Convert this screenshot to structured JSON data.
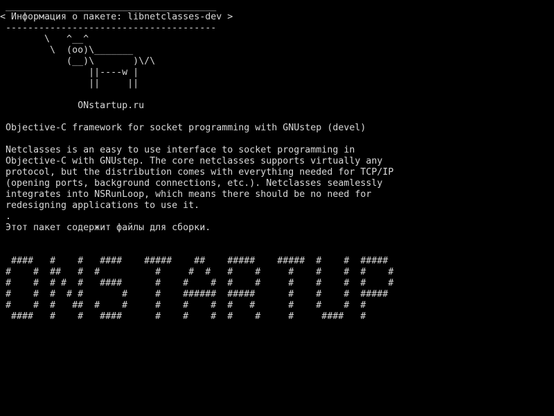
{
  "terminal": {
    "colors": {
      "background": "#000000",
      "foreground": "#d8d8d8"
    },
    "bubble": {
      "top_border": " ______________________________________",
      "text": "< Информация о пакете: libnetclasses-dev >",
      "bottom_border": " --------------------------------------"
    },
    "cow": {
      "lines": [
        "       \\   ^__^",
        "        \\  (oo)\\_______",
        "           (__)\\       )\\/\\",
        "               ||----w |",
        "               ||     ||"
      ]
    },
    "site": "             ONstartup.ru",
    "summary": "Objective-C framework for socket programming with GNUstep (devel)",
    "description": [
      "Netclasses is an easy to use interface to socket programming in",
      "Objective-C with GNUstep. The core netclasses supports virtually any",
      "protocol, but the distribution comes with everything needed for TCP/IP",
      "(opening ports, background connections, etc.). Netclasses seamlessly",
      "integrates into NSRunLoop, which means there should be no need for",
      "redesigning applications to use it.",
      "."
    ],
    "note": "Этот пакет содержит файлы для сборки.",
    "banner": [
      " ####   #    #   ####    #####    ##    #####    #####  #    #  #####",
      "#    #  ##   #  #          #     #  #   #    #     #    #    #  #    #",
      "#    #  # #  #   ####      #    #    #  #    #     #    #    #  #    #",
      "#    #  #  # #       #     #    ######  #####      #    #    #  #####",
      "#    #  #   ##  #    #     #    #    #  #   #      #    #    #  #",
      " ####   #    #   ####      #    #    #  #    #     #     ####   #"
    ]
  }
}
